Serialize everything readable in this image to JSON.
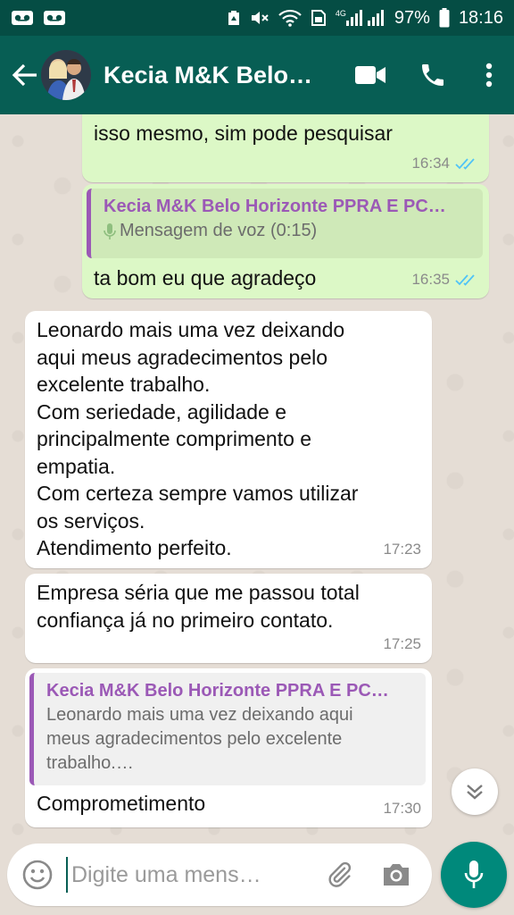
{
  "status_bar": {
    "battery": "97%",
    "time": "18:16",
    "network": "4G"
  },
  "header": {
    "title": "Kecia M&K Belo…"
  },
  "messages": [
    {
      "text": "isso mesmo, sim pode pesquisar",
      "time": "16:34",
      "ticks": "read"
    },
    {
      "quote": {
        "author": "Kecia M&K Belo Horizonte PPRA E PC…",
        "text": "Mensagem de voz (0:15)"
      },
      "text": "ta bom eu que agradeço",
      "time": "16:35",
      "ticks": "read"
    },
    {
      "text": "Leonardo mais uma vez deixando\naqui meus agradecimentos pelo\nexcelente trabalho.\nCom seriedade, agilidade e\nprincipalmente comprimento e\nempatia.\nCom certeza sempre vamos utilizar\nos serviços.\nAtendimento perfeito.",
      "time": "17:23"
    },
    {
      "text": "Empresa séria que me passou total\nconfiança já no primeiro contato.",
      "time": "17:25"
    },
    {
      "quote": {
        "author": "Kecia M&K Belo Horizonte PPRA E PC…",
        "text": "Leonardo mais uma vez deixando aqui\nmeus agradecimentos pelo excelente\ntrabalho.…"
      },
      "text": "Comprometimento",
      "time": "17:30"
    }
  ],
  "composer": {
    "placeholder": "Digite uma mens…"
  },
  "colors": {
    "header": "#075e54",
    "status_bar": "#054d44",
    "outgoing_bubble": "#dcf8c6",
    "incoming_bubble": "#ffffff",
    "quote_accent": "#9b59b6",
    "read_ticks": "#4fc3f7",
    "mic_button": "#00897b"
  },
  "icons": {
    "back": "arrow-left-icon",
    "video": "video-camera-icon",
    "call": "phone-icon",
    "menu": "more-vertical-icon",
    "emoji": "emoji-icon",
    "attach": "paperclip-icon",
    "camera": "camera-icon",
    "mic": "microphone-icon",
    "scroll": "double-chevron-down-icon"
  }
}
